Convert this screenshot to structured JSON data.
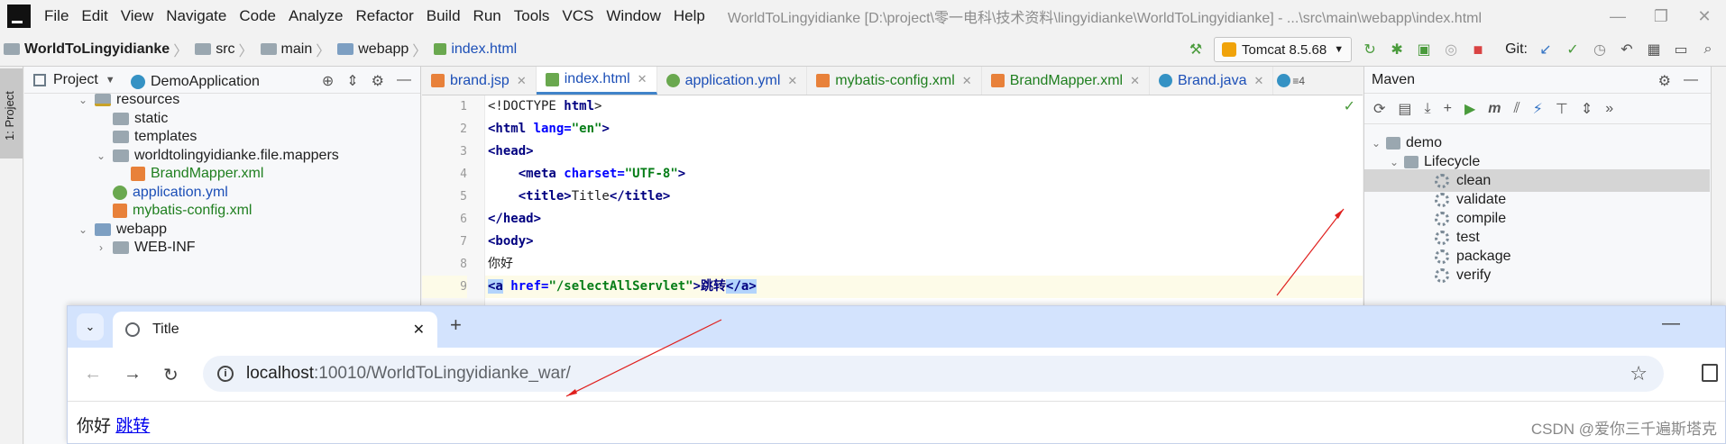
{
  "menubar": {
    "items": [
      "File",
      "Edit",
      "View",
      "Navigate",
      "Code",
      "Analyze",
      "Refactor",
      "Build",
      "Run",
      "Tools",
      "VCS",
      "Window",
      "Help"
    ],
    "window_title": "WorldToLingyidianke [D:\\project\\零一电科\\技术资料\\lingyidianke\\WorldToLingyidianke] - ...\\src\\main\\webapp\\index.html"
  },
  "breadcrumb": [
    "WorldToLingyidianke",
    "src",
    "main",
    "webapp",
    "index.html"
  ],
  "toolbar": {
    "run_config": "Tomcat 8.5.68",
    "git_label": "Git:"
  },
  "left_stripe": {
    "project_tab": "1: Project"
  },
  "project_panel": {
    "title": "Project",
    "tree": [
      {
        "label": "DemoApplication",
        "icon": "class-icon"
      },
      {
        "label": "resources",
        "icon": "resources-folder-icon"
      },
      {
        "label": "static",
        "icon": "folder-icon"
      },
      {
        "label": "templates",
        "icon": "folder-icon"
      },
      {
        "label": "worldtolingyidianke.file.mappers",
        "icon": "folder-icon"
      },
      {
        "label": "BrandMapper.xml",
        "icon": "xml-icon"
      },
      {
        "label": "application.yml",
        "icon": "yml-icon"
      },
      {
        "label": "mybatis-config.xml",
        "icon": "xml-icon"
      },
      {
        "label": "webapp",
        "icon": "folder-icon"
      },
      {
        "label": "WEB-INF",
        "icon": "folder-icon"
      }
    ]
  },
  "editor": {
    "tabs": [
      {
        "label": "brand.jsp",
        "icon": "jsp-icon",
        "active": false
      },
      {
        "label": "index.html",
        "icon": "html-icon",
        "active": true
      },
      {
        "label": "application.yml",
        "icon": "yml-icon",
        "active": false
      },
      {
        "label": "mybatis-config.xml",
        "icon": "xml-icon",
        "active": false
      },
      {
        "label": "BrandMapper.xml",
        "icon": "xml-icon",
        "active": false
      },
      {
        "label": "Brand.java",
        "icon": "class-icon",
        "active": false
      }
    ],
    "tab_overflow": "4",
    "line_numbers": [
      "1",
      "2",
      "3",
      "4",
      "5",
      "6",
      "7",
      "8",
      "9"
    ],
    "code": {
      "l1_a": "<!DOCTYPE ",
      "l1_b": "html",
      "l1_c": ">",
      "l2_a": "<html ",
      "l2_b": "lang",
      "l2_c": "=",
      "l2_d": "\"en\"",
      "l2_e": ">",
      "l3": "<head>",
      "l4_a": "    <meta ",
      "l4_b": "charset",
      "l4_c": "=",
      "l4_d": "\"UTF-8\"",
      "l4_e": ">",
      "l5_a": "    <title>",
      "l5_b": "Title",
      "l5_c": "</title>",
      "l6": "</head>",
      "l7": "<body>",
      "l8": "你好",
      "l9_a": "<a",
      "l9_b": " href",
      "l9_c": "=",
      "l9_d": "\"/selectAllServlet\"",
      "l9_e": ">跳转",
      "l9_f": "</a>"
    }
  },
  "maven": {
    "title": "Maven",
    "root": "demo",
    "lifecycle": "Lifecycle",
    "phases": [
      "clean",
      "validate",
      "compile",
      "test",
      "package",
      "verify"
    ],
    "selected": "clean"
  },
  "browser": {
    "tab_title": "Title",
    "url_host": "localhost",
    "url_rest": ":10010/WorldToLingyidianke_war/",
    "content_text": "你好 ",
    "content_link": "跳转"
  },
  "watermark": "CSDN @爱你三千遍斯塔克",
  "colors": {
    "accent": "#4083c9",
    "annotation_arrow": "#e0201e",
    "browser_tabstrip": "#d3e3fd"
  }
}
